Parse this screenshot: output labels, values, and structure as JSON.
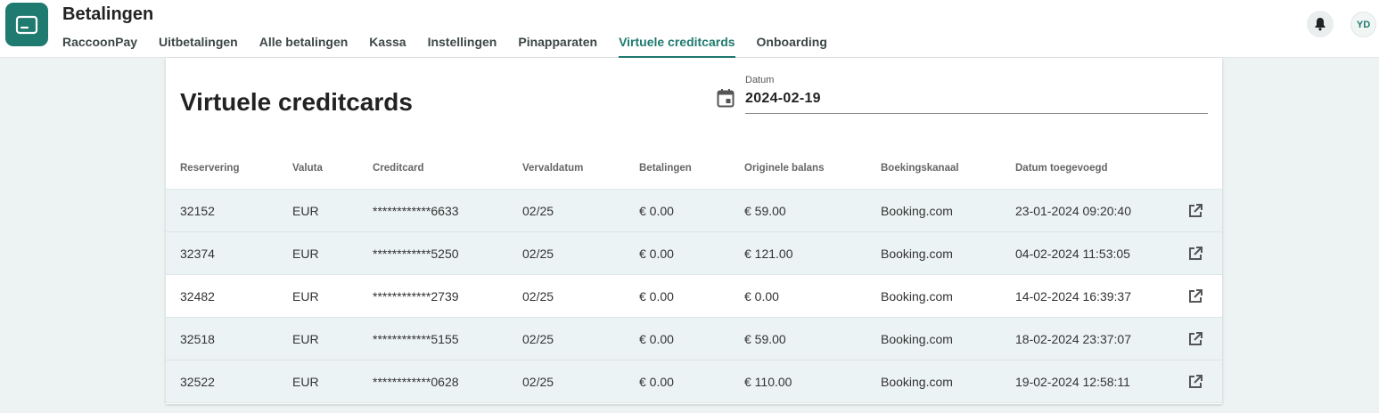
{
  "app": {
    "title": "Betalingen",
    "icon": "credit-card-icon"
  },
  "nav": {
    "items": [
      {
        "label": "RaccoonPay",
        "active": false
      },
      {
        "label": "Uitbetalingen",
        "active": false
      },
      {
        "label": "Alle betalingen",
        "active": false
      },
      {
        "label": "Kassa",
        "active": false
      },
      {
        "label": "Instellingen",
        "active": false
      },
      {
        "label": "Pinapparaten",
        "active": false
      },
      {
        "label": "Virtuele creditcards",
        "active": true
      },
      {
        "label": "Onboarding",
        "active": false
      }
    ]
  },
  "user": {
    "initials": "YD",
    "notifications_icon": "bell-icon"
  },
  "page": {
    "title": "Virtuele creditcards"
  },
  "date_filter": {
    "label": "Datum",
    "value": "2024-02-19",
    "icon": "calendar-icon"
  },
  "table": {
    "columns": [
      "Reservering",
      "Valuta",
      "Creditcard",
      "Vervaldatum",
      "Betalingen",
      "Originele balans",
      "Boekingskanaal",
      "Datum toegevoegd"
    ],
    "rows": [
      {
        "cells": [
          "32152",
          "EUR",
          "************6633",
          "02/25",
          "€ 0.00",
          "€ 59.00",
          "Booking.com",
          "23-01-2024 09:20:40"
        ],
        "shaded": true
      },
      {
        "cells": [
          "32374",
          "EUR",
          "************5250",
          "02/25",
          "€ 0.00",
          "€ 121.00",
          "Booking.com",
          "04-02-2024 11:53:05"
        ],
        "shaded": true
      },
      {
        "cells": [
          "32482",
          "EUR",
          "************2739",
          "02/25",
          "€ 0.00",
          "€ 0.00",
          "Booking.com",
          "14-02-2024 16:39:37"
        ],
        "shaded": false
      },
      {
        "cells": [
          "32518",
          "EUR",
          "************5155",
          "02/25",
          "€ 0.00",
          "€ 59.00",
          "Booking.com",
          "18-02-2024 23:37:07"
        ],
        "shaded": true
      },
      {
        "cells": [
          "32522",
          "EUR",
          "************0628",
          "02/25",
          "€ 0.00",
          "€ 110.00",
          "Booking.com",
          "19-02-2024 12:58:11"
        ],
        "shaded": true
      }
    ],
    "row_action_icon": "open-external-icon"
  },
  "colors": {
    "accent": "#1f7a6f",
    "background": "#ecf3f2",
    "row_shade": "#ecf3f4"
  }
}
